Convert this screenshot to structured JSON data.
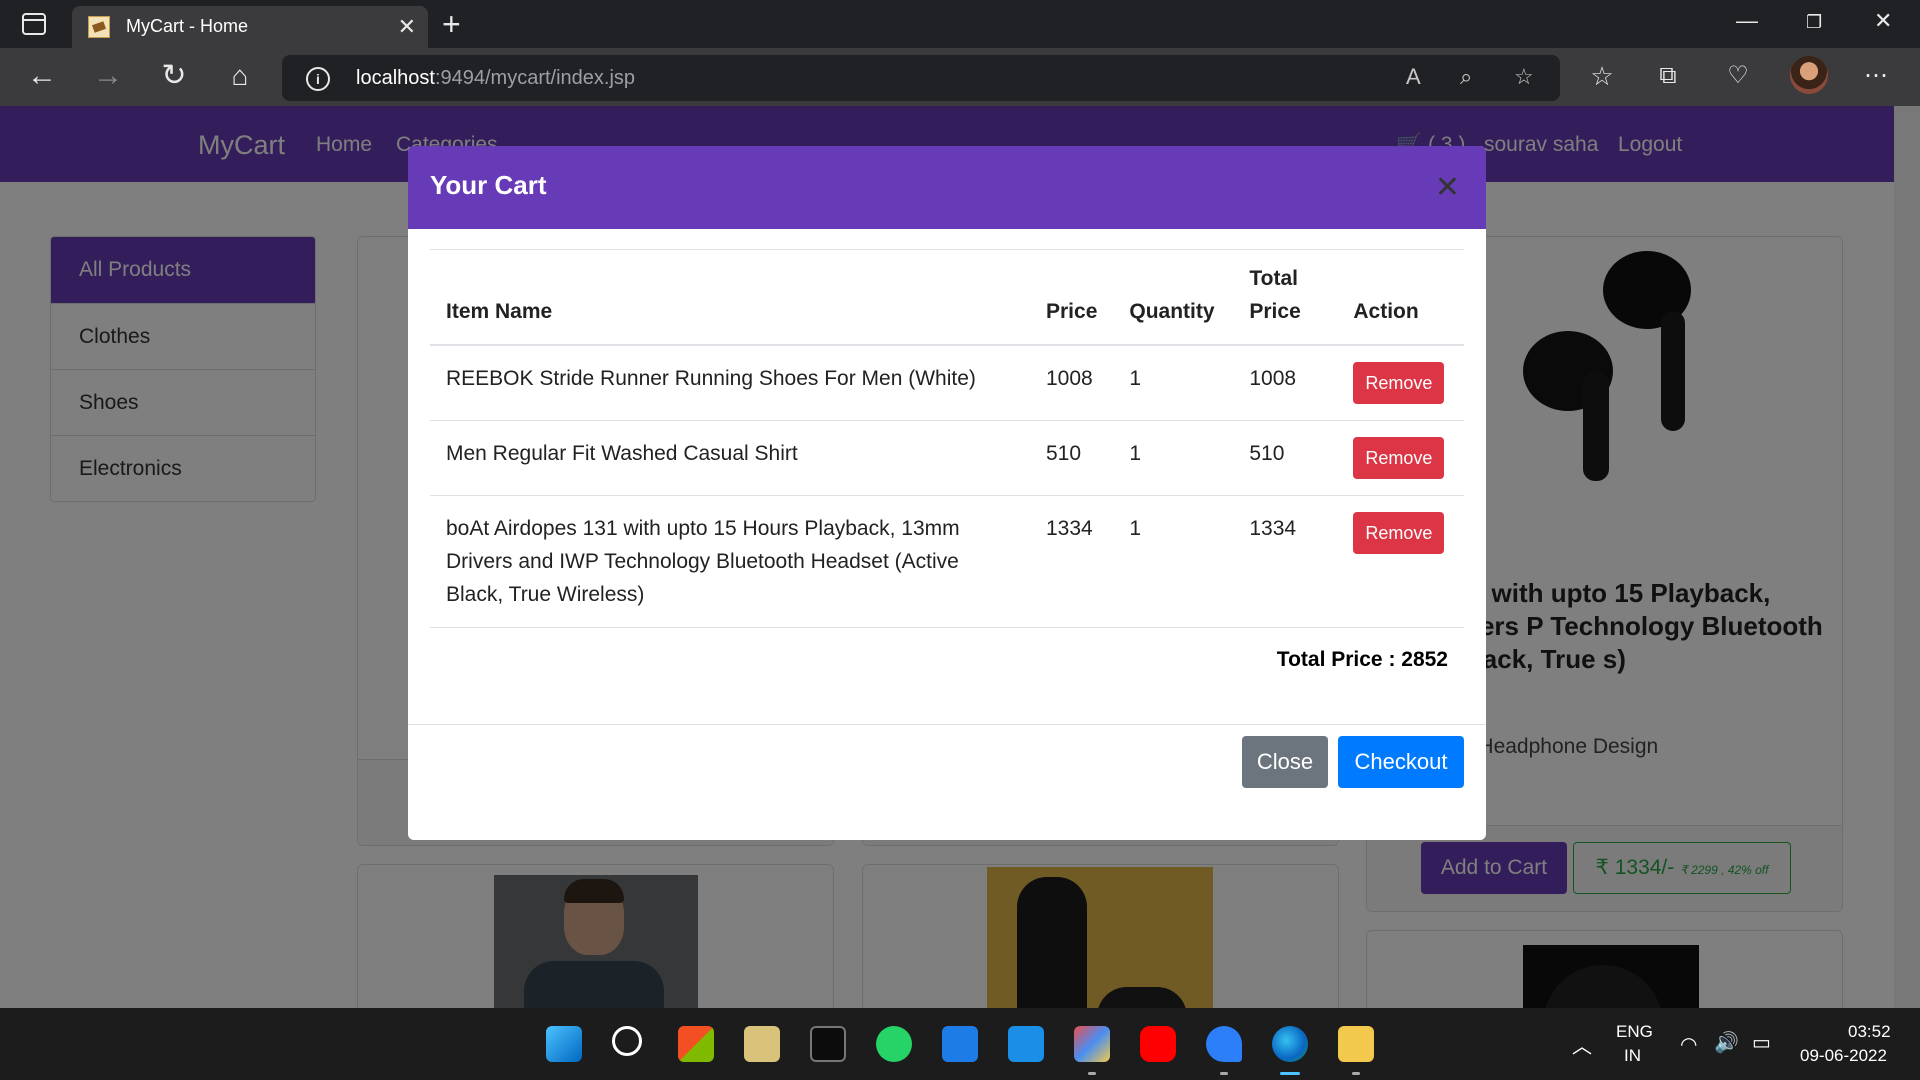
{
  "browser": {
    "tab_title": "MyCart - Home",
    "url_host": "localhost",
    "url_path": ":9494/mycart/index.jsp"
  },
  "site": {
    "brand": "MyCart",
    "nav": {
      "home": "Home",
      "categories": "Categories",
      "cart_count": "( 3 )",
      "user": "sourav saha",
      "logout": "Logout"
    }
  },
  "sidebar": {
    "items": [
      {
        "label": "All Products"
      },
      {
        "label": "Clothes"
      },
      {
        "label": "Shoes"
      },
      {
        "label": "Electronics"
      }
    ]
  },
  "background_card": {
    "title": "rdopes 131 with upto 15 Playback, 13mm Drivers P Technology Bluetooth t (Active Black, True s)",
    "text": "ity Bluetooth Headphone Design",
    "add_to_cart": "Add to Cart",
    "price": "₹ 1334/-",
    "original_price": "₹ 2299 , 42% off"
  },
  "cart_modal": {
    "title": "Your Cart",
    "columns": [
      "Item Name",
      "Price",
      "Quantity",
      "Total Price",
      "Action"
    ],
    "rows": [
      {
        "name": "REEBOK Stride Runner Running Shoes For Men (White)",
        "price": "1008",
        "quantity": "1",
        "total": "1008",
        "action": "Remove"
      },
      {
        "name": "Men Regular Fit Washed Casual Shirt",
        "price": "510",
        "quantity": "1",
        "total": "510",
        "action": "Remove"
      },
      {
        "name": "boAt Airdopes 131 with upto 15 Hours Playback, 13mm Drivers and IWP Technology Bluetooth Headset (Active Black, True Wireless)",
        "price": "1334",
        "quantity": "1",
        "total": "1334",
        "action": "Remove"
      }
    ],
    "total_label": "Total Price : 2852",
    "close": "Close",
    "checkout": "Checkout"
  },
  "taskbar": {
    "lang_1": "ENG",
    "lang_2": "IN",
    "time": "03:52",
    "date": "09-06-2022"
  },
  "colors": {
    "brand": "#673ab7",
    "danger": "#dc3545",
    "primary": "#007bff",
    "secondary": "#6c757d",
    "success": "#28a745"
  }
}
